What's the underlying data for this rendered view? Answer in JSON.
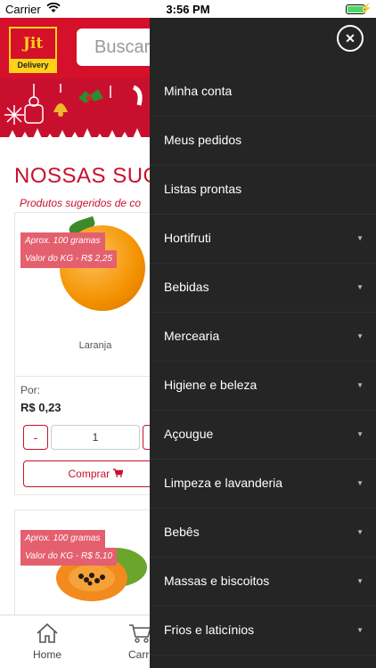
{
  "status_bar": {
    "carrier": "Carrier",
    "time": "3:56 PM"
  },
  "header": {
    "logo_title": "Jit",
    "logo_sub": "Delivery",
    "search_placeholder": "Buscar"
  },
  "section": {
    "title": "NOSSAS SUG",
    "subtitle": "Produtos sugeridos de co"
  },
  "products": [
    {
      "tag_weight": "Aprox. 100 gramas",
      "tag_price": "Valor do KG - R$ 2,25",
      "name": "Laranja",
      "price_label": "Por:",
      "price": "R$ 0,23",
      "qty_minus": "-",
      "qty_value": "1",
      "qty_plus": "+",
      "buy_label": "Comprar"
    },
    {
      "tag_weight": "Aprox. 100 gramas",
      "tag_price": "Valor do KG - R$ 5,10"
    }
  ],
  "tabs": {
    "home": "Home",
    "cart": "Carri"
  },
  "drawer": {
    "close": "✕",
    "items": [
      {
        "label": "Minha conta",
        "has_sub": false
      },
      {
        "label": "Meus pedidos",
        "has_sub": false
      },
      {
        "label": "Listas prontas",
        "has_sub": false
      },
      {
        "label": "Hortifruti",
        "has_sub": true
      },
      {
        "label": "Bebidas",
        "has_sub": true
      },
      {
        "label": "Mercearia",
        "has_sub": true
      },
      {
        "label": "Higiene e beleza",
        "has_sub": true
      },
      {
        "label": "Açougue",
        "has_sub": true
      },
      {
        "label": "Limpeza e lavanderia",
        "has_sub": true
      },
      {
        "label": "Bebês",
        "has_sub": true
      },
      {
        "label": "Massas e biscoitos",
        "has_sub": true
      },
      {
        "label": "Frios e laticínios",
        "has_sub": true
      }
    ]
  },
  "colors": {
    "brand_red": "#d4102a",
    "drawer_bg": "#252525",
    "tag_bg": "#e4606f",
    "logo_yellow": "#ffd21a"
  }
}
